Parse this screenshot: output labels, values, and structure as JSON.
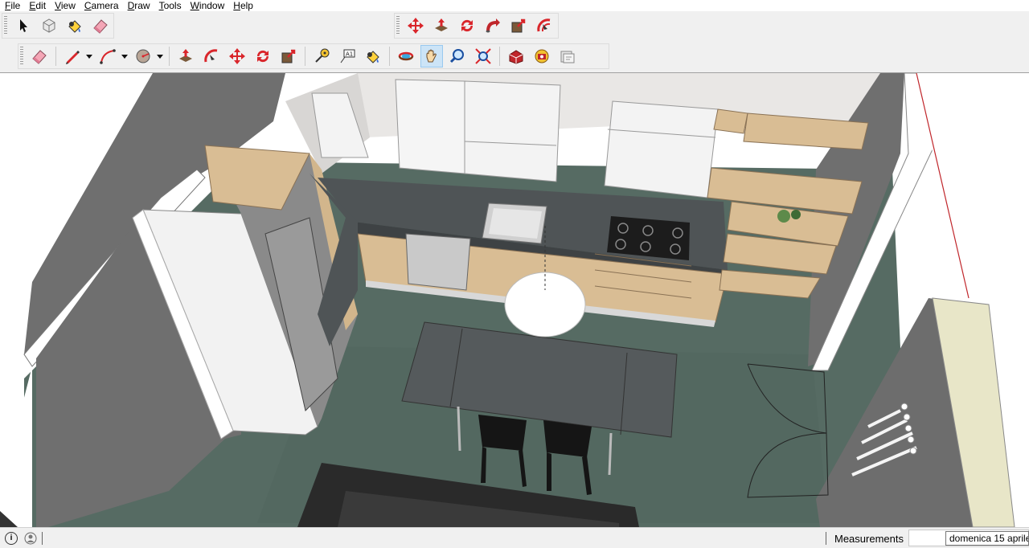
{
  "menu": {
    "items": [
      {
        "label": "File"
      },
      {
        "label": "Edit"
      },
      {
        "label": "View"
      },
      {
        "label": "Camera"
      },
      {
        "label": "Draw"
      },
      {
        "label": "Tools"
      },
      {
        "label": "Window"
      },
      {
        "label": "Help"
      }
    ]
  },
  "toolbar_top_left": {
    "tools": [
      "select-tool-icon",
      "component-icon",
      "paint-bucket-icon",
      "eraser-icon"
    ]
  },
  "toolbar_top_right": {
    "tools": [
      "move-icon",
      "push-pull-icon",
      "rotate-icon",
      "follow-me-icon",
      "scale-icon",
      "offset-icon"
    ]
  },
  "toolbar_main": {
    "tools": [
      "eraser-icon",
      "pencil-line-icon",
      "arc-icon",
      "circle-icon",
      "push-pull-icon",
      "follow-me-icon",
      "move-icon",
      "rotate-icon",
      "scale-icon",
      "tape-measure-icon",
      "text-icon",
      "paint-bucket-icon",
      "orbit-icon",
      "pan-icon",
      "zoom-icon",
      "zoom-extents-icon",
      "warehouse-icon",
      "extension-warehouse-icon",
      "layout-send-icon"
    ],
    "active_tool": "pan-icon"
  },
  "status": {
    "info_icon": "info-icon",
    "user_icon": "user-icon",
    "measurements_label": "Measurements",
    "measurements_value": "",
    "tooltip": "domenica 15 aprile"
  },
  "colors": {
    "accent_red": "#d9262b",
    "floor": "#566b63",
    "counter": "#4f5456",
    "wood": "#d9bd94",
    "wall_dark": "#6f6f6f"
  }
}
